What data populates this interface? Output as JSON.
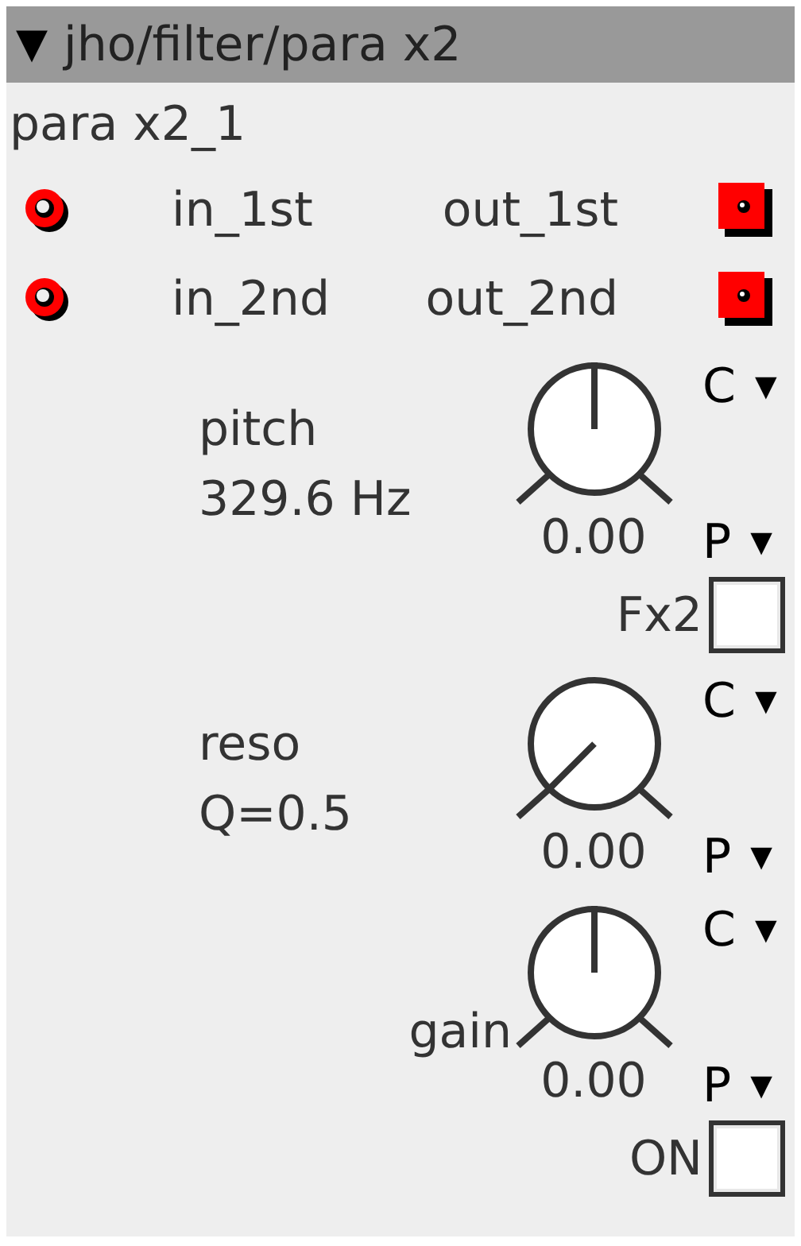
{
  "title": {
    "arrow": "▼",
    "text": "jho/filter/para x2"
  },
  "instance": "para x2_1",
  "ports": [
    {
      "inlet": "in_1st",
      "outlet": "out_1st"
    },
    {
      "inlet": "in_2nd",
      "outlet": "out_2nd"
    }
  ],
  "params": [
    {
      "kind": "knob",
      "labels": [
        "pitch",
        "329.6 Hz"
      ],
      "value": "0.00",
      "c": "C",
      "p": "P",
      "arrow": "▼"
    },
    {
      "kind": "toggle",
      "label": "Fx2",
      "checked": false
    },
    {
      "kind": "knob",
      "labels": [
        "reso",
        "Q=0.5"
      ],
      "value": "0.00",
      "c": "C",
      "p": "P",
      "arrow": "▼"
    },
    {
      "kind": "knob",
      "labels": [
        "gain"
      ],
      "value": "0.00",
      "c": "C",
      "p": "P",
      "arrow": "▼"
    },
    {
      "kind": "toggle",
      "label": "ON",
      "checked": false
    }
  ]
}
